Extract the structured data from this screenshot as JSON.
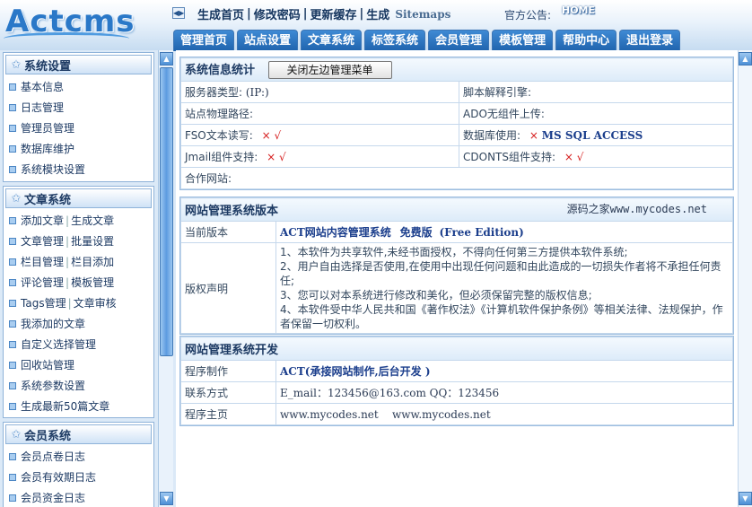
{
  "header": {
    "logo_text": "Actcms",
    "quick_links": [
      "生成首页",
      "修改密码",
      "更新缓存",
      "生成"
    ],
    "sitemaps_label": "Sitemaps",
    "notice_label": "官方公告:",
    "notice_text": "HOME",
    "toggle_icon": "double-arrow-icon"
  },
  "tabs": [
    "管理首页",
    "站点设置",
    "文章系统",
    "标签系统",
    "会员管理",
    "模板管理",
    "帮助中心",
    "退出登录"
  ],
  "sidebar": {
    "groups": [
      {
        "title": "系统设置",
        "items": [
          "基本信息",
          "日志管理",
          "管理员管理",
          "数据库维护",
          "系统模块设置"
        ]
      },
      {
        "title": "文章系统",
        "items": [
          [
            "添加文章",
            "生成文章"
          ],
          [
            "文章管理",
            "批量设置"
          ],
          [
            "栏目管理",
            "栏目添加"
          ],
          [
            "评论管理",
            "模板管理"
          ],
          [
            "Tags管理",
            "文章审核"
          ],
          "我添加的文章",
          "自定义选择管理",
          "回收站管理",
          "系统参数设置",
          "生成最新50篇文章"
        ]
      },
      {
        "title": "会员系统",
        "items": [
          "会员点卷日志",
          "会员有效期日志",
          "会员资金日志"
        ]
      }
    ]
  },
  "sysinfo": {
    "title": "系统信息统计",
    "close_menu_button": "关闭左边管理菜单",
    "server_type_label": "服务器类型:",
    "server_type_value": "(IP:)",
    "script_engine_label": "脚本解释引擎:",
    "physical_path_label": "站点物理路径:",
    "ado_label": "ADO无组件上传:",
    "fso_label": "FSO文本读写:",
    "db_label": "数据库使用:",
    "db_value": "MS SQL ACCESS",
    "jmail_label": "Jmail组件支持:",
    "cdonts_label": "CDONTS组件支持:",
    "partner_label": "合作网站:",
    "cross": "×",
    "check": "√"
  },
  "version": {
    "title": "网站管理系统版本",
    "site_note": "源码之家www.mycodes.net",
    "current_label": "当前版本",
    "current_name": "ACT网站内容管理系统",
    "current_edition": "免费版",
    "current_edition_en": "(Free Edition)",
    "copyright_label": "版权声明",
    "copyright_lines": [
      "1、本软件为共享软件,未经书面授权，不得向任何第三方提供本软件系统;",
      "2、用户自由选择是否使用,在使用中出现任何问题和由此造成的一切损失作者将不承担任何责任;",
      "3、您可以对本系统进行修改和美化，但必须保留完整的版权信息;",
      "4、本软件受中华人民共和国《著作权法》《计算机软件保护条例》等相关法律、法规保护，作者保留一切权利。"
    ]
  },
  "dev": {
    "title": "网站管理系统开发",
    "author_label": "程序制作",
    "author_value": "ACT(承接网站制作,后台开发 )",
    "contact_label": "联系方式",
    "contact_value": "E_mail：123456@163.com QQ：123456",
    "homepage_label": "程序主页",
    "homepage_value": "www.mycodes.net    www.mycodes.net"
  }
}
